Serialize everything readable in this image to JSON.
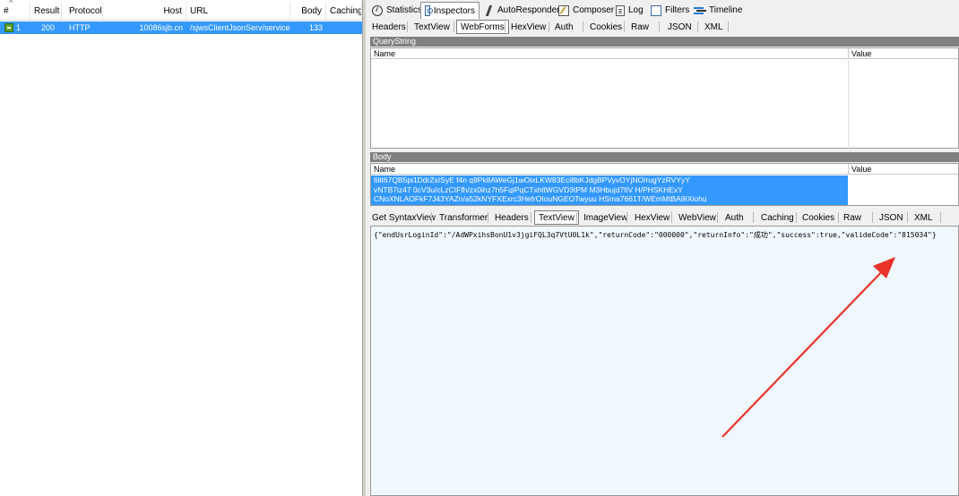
{
  "sessions": {
    "columns": {
      "num": "#",
      "result": "Result",
      "protocol": "Protocol",
      "host": "Host",
      "url": "URL",
      "body": "Body",
      "caching": "Caching"
    },
    "rows": [
      {
        "num": "1",
        "result": "200",
        "protocol": "HTTP",
        "host": "10086sjb.cn",
        "url": "/sjwsClientJsonServ/service",
        "body": "133",
        "caching": ""
      }
    ]
  },
  "top_tabs": {
    "statistics": "Statistics",
    "inspectors": "Inspectors",
    "autoresponder": "AutoResponder",
    "composer": "Composer",
    "log": "Log",
    "filters": "Filters",
    "timeline": "Timeline"
  },
  "request_tabs": {
    "headers": "Headers",
    "textview": "TextView",
    "webforms": "WebForms",
    "hexview": "HexView",
    "auth": "Auth",
    "cookies": "Cookies",
    "raw": "Raw",
    "json": "JSON",
    "xml": "XML"
  },
  "querystring": {
    "title": "QueryString",
    "name_col": "Name",
    "value_col": "Value"
  },
  "body_section": {
    "title": "Body",
    "name_col": "Name",
    "value_col": "Value",
    "name_lines": [
      "6lit67QB5pi1DdrZsISyE f4n q9Pk8AWeGj1wOixLKW83Eci8bKJdgBPVyvOYjNO/rugYzRVYyY",
      "vNTB7iz47 0cV3u/cLzCIFfh/zx0ihz7h5FqlPqCTxhltWGVD3tPM M3Hbujd7lIV H/PHSKHExY",
      "CNoXNLAOFkF7J43YAZn/a52kNYFXExrc3HefrOIouNGEOTwyuu HSma7661T/WEmMtBA9IXiohu"
    ]
  },
  "response_tabs": {
    "syntaxview": "Get SyntaxView",
    "transformer": "Transformer",
    "headers": "Headers",
    "textview": "TextView",
    "imageview": "ImageView",
    "hexview": "HexView",
    "webview": "WebView",
    "auth": "Auth",
    "caching": "Caching",
    "cookies": "Cookies",
    "raw": "Raw",
    "json": "JSON",
    "xml": "XML"
  },
  "response_text": "{\"endUsrLoginId\":\"/AdWPxihsBonU1v3jgiFQL3q7VtU0L1k\",\"returnCode\":\"000000\",\"returnInfo\":\"成功\",\"success\":true,\"valideCode\":\"815034\"}",
  "colors": {
    "selection": "#3399ff",
    "arrow": "#e8332a",
    "textview_bg": "#f0f8fe"
  }
}
